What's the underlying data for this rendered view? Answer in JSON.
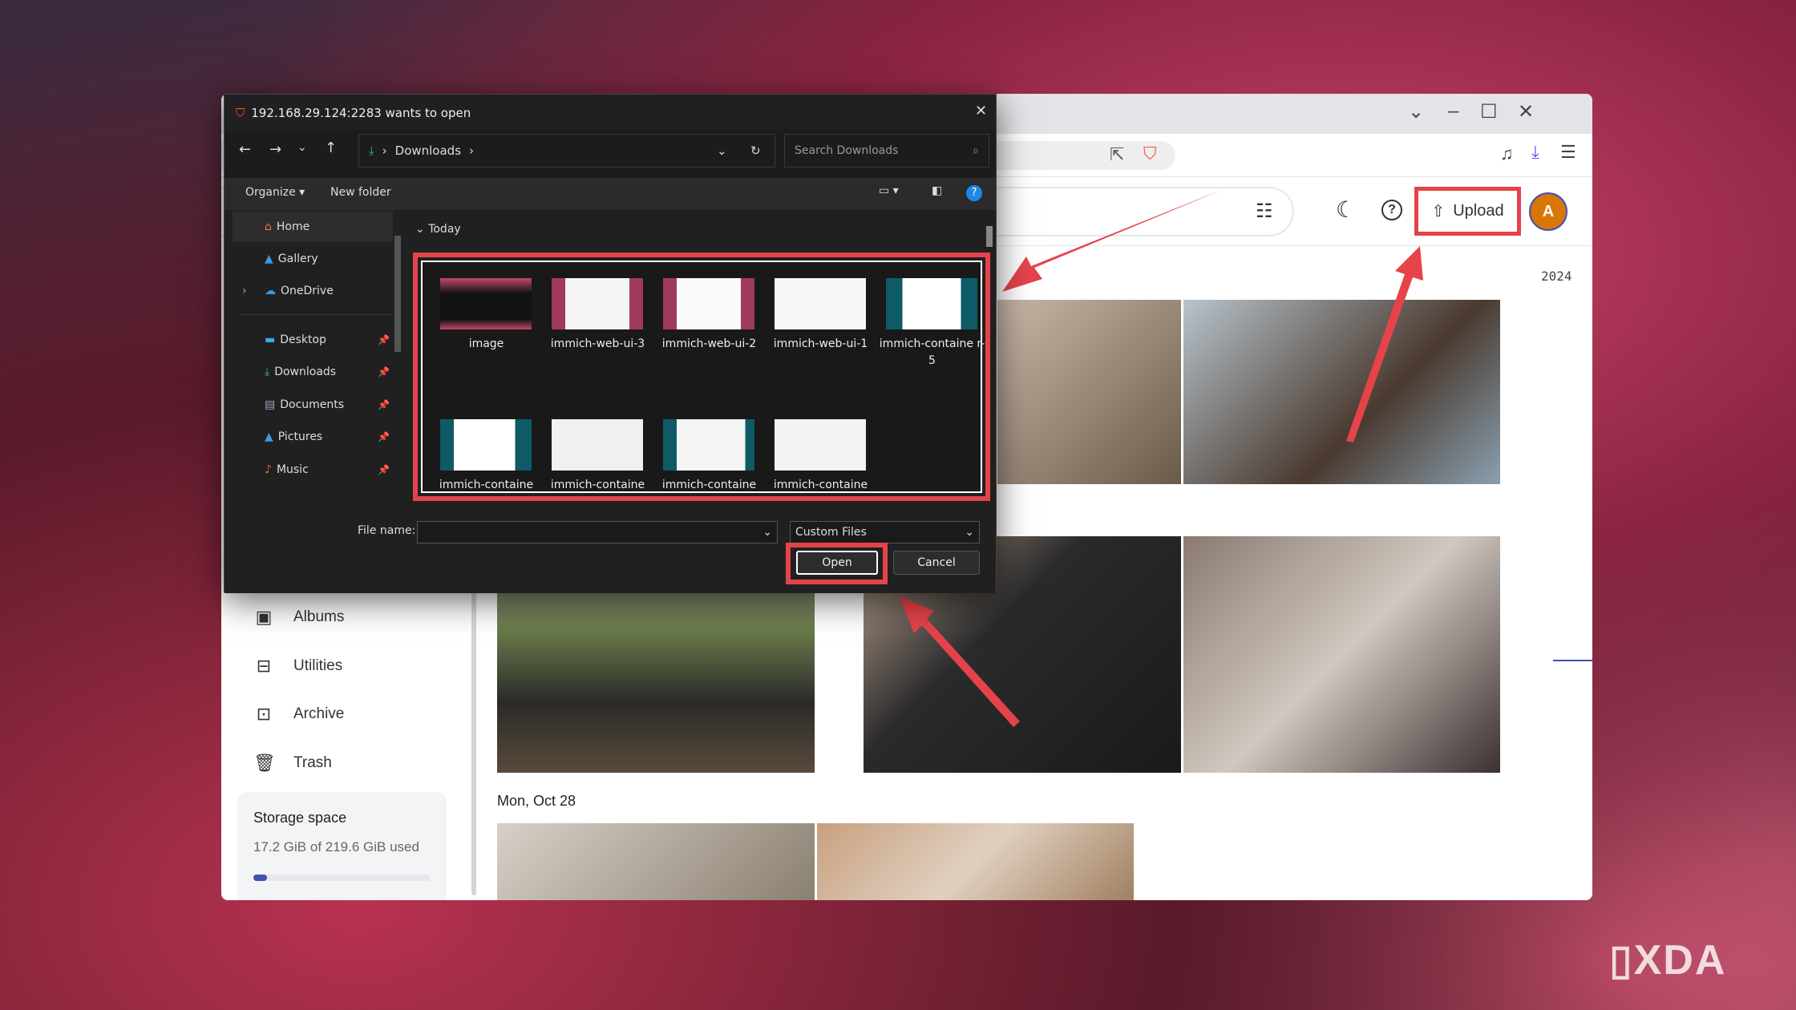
{
  "dialog": {
    "title": "192.168.29.124:2283 wants to open",
    "path": "Downloads",
    "search_placeholder": "Search Downloads",
    "organize": "Organize",
    "new_folder": "New folder",
    "group": "Today",
    "nav": [
      {
        "label": "Home",
        "icon": "home-icon"
      },
      {
        "label": "Gallery",
        "icon": "gallery-icon"
      },
      {
        "label": "OneDrive",
        "icon": "cloud-icon"
      },
      {
        "label": "Desktop",
        "icon": "desktop-icon"
      },
      {
        "label": "Downloads",
        "icon": "download-icon"
      },
      {
        "label": "Documents",
        "icon": "document-icon"
      },
      {
        "label": "Pictures",
        "icon": "pictures-icon"
      },
      {
        "label": "Music",
        "icon": "music-icon"
      }
    ],
    "files": [
      "image",
      "immich-web-ui-3",
      "immich-web-ui-2",
      "immich-web-ui-1",
      "immich-containe r-5",
      "immich-containe",
      "immich-containe",
      "immich-containe",
      "immich-containe"
    ],
    "file_name_label": "File name:",
    "file_name_value": "",
    "filter": "Custom Files",
    "open": "Open",
    "cancel": "Cancel"
  },
  "app": {
    "upload": "Upload",
    "avatar": "A",
    "year": "2024",
    "date_group": "Mon, Oct 28",
    "sidebar": [
      {
        "label": "Albums",
        "icon": "albums-icon"
      },
      {
        "label": "Utilities",
        "icon": "toolbox-icon"
      },
      {
        "label": "Archive",
        "icon": "archive-icon"
      },
      {
        "label": "Trash",
        "icon": "trash-icon"
      }
    ],
    "storage": {
      "title": "Storage space",
      "usage": "17.2 GiB of 219.6 GiB used",
      "used_fraction": 0.078
    }
  },
  "colors": {
    "highlight": "#e5434a",
    "accent": "#4250af",
    "avatar": "#d97706"
  },
  "watermark": "XDA"
}
